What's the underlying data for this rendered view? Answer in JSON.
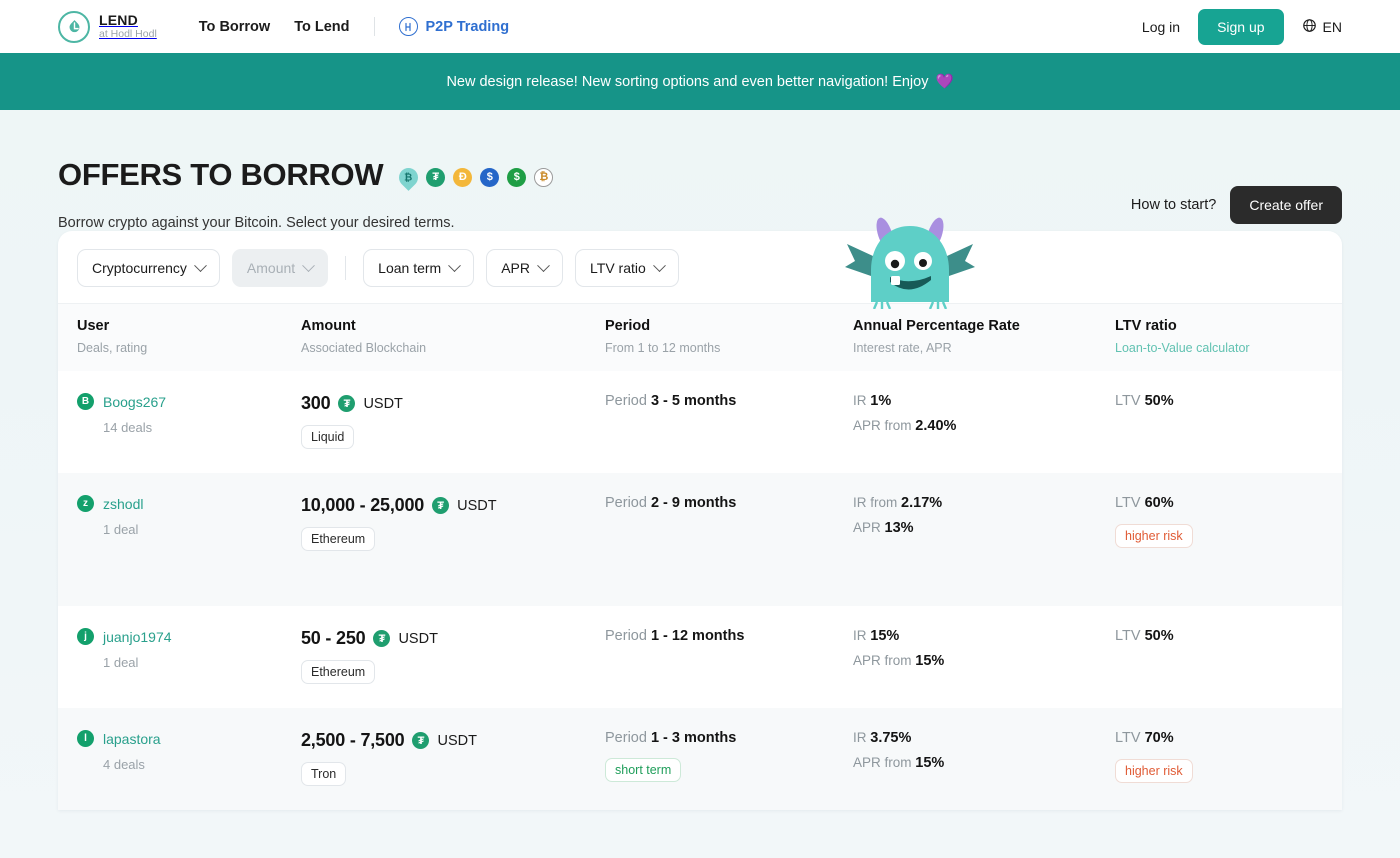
{
  "header": {
    "logo": {
      "title": "LEND",
      "subtitle": "at Hodl Hodl",
      "icon": "lend-leaf-icon"
    },
    "nav": [
      {
        "label": "To Borrow"
      },
      {
        "label": "To Lend"
      }
    ],
    "p2p": {
      "label": "P2P Trading",
      "icon": "p2p-hodlhodl-icon",
      "color": "#2f6fd0"
    },
    "login_label": "Log in",
    "signup_label": "Sign up",
    "language": {
      "label": "EN",
      "icon": "globe-icon"
    }
  },
  "banner": {
    "text": "New design release! New sorting options and even better navigation! Enjoy",
    "emoji": "💜",
    "background": "#169488"
  },
  "hero": {
    "title": "Offers to borrow",
    "subtitle": "Borrow crypto against your Bitcoin. Select your desired terms.",
    "coins": [
      {
        "name": "liquid-bitcoin-icon",
        "symbol": "₿",
        "class": "liquid"
      },
      {
        "name": "tether-icon",
        "symbol": "₮",
        "class": "usdt"
      },
      {
        "name": "dai-icon",
        "symbol": "Đ",
        "class": "dai"
      },
      {
        "name": "usdc-icon",
        "symbol": "$",
        "class": "usdc"
      },
      {
        "name": "usd-icon",
        "symbol": "$",
        "class": "usdx"
      },
      {
        "name": "bitcoin-icon",
        "symbol": "₿",
        "class": "btc"
      }
    ],
    "how_to_start": "How to start?",
    "create_offer": "Create offer",
    "mascot": "monster-mascot-illustration"
  },
  "filters": [
    {
      "label": "Cryptocurrency",
      "disabled": false
    },
    {
      "label": "Amount",
      "disabled": true
    },
    {
      "label": "Loan term",
      "disabled": false
    },
    {
      "label": "APR",
      "disabled": false
    },
    {
      "label": "LTV ratio",
      "disabled": false
    }
  ],
  "table": {
    "columns": [
      {
        "title": "User",
        "sub": "Deals, rating",
        "sub_is_link": false
      },
      {
        "title": "Amount",
        "sub": "Associated Blockchain",
        "sub_is_link": false
      },
      {
        "title": "Period",
        "sub": "From 1 to 12 months",
        "sub_is_link": false
      },
      {
        "title": "Annual Percentage Rate",
        "sub": "Interest rate, APR",
        "sub_is_link": false
      },
      {
        "title": "LTV ratio",
        "sub": "Loan-to-Value calculator",
        "sub_is_link": true
      }
    ],
    "rows": [
      {
        "avatar": "B",
        "username": "Boogs267",
        "deals": "14 deals",
        "amount": "300",
        "currency": "USDT",
        "blockchain": "Liquid",
        "period_label": "Period",
        "period_value": "3 - 5 months",
        "period_tag": "",
        "rate1_label": "IR",
        "rate1_value": "1%",
        "rate2_label": "APR from",
        "rate2_value": "2.40%",
        "ltv_label": "LTV",
        "ltv_value": "50%",
        "risk": ""
      },
      {
        "avatar": "z",
        "username": "zshodl",
        "deals": "1 deal",
        "amount": "10,000 - 25,000",
        "currency": "USDT",
        "blockchain": "Ethereum",
        "period_label": "Period",
        "period_value": "2 - 9 months",
        "period_tag": "",
        "rate1_label": "IR from",
        "rate1_value": "2.17%",
        "rate2_label": "APR",
        "rate2_value": "13%",
        "ltv_label": "LTV",
        "ltv_value": "60%",
        "risk": "higher risk"
      },
      {
        "avatar": "j",
        "username": "juanjo1974",
        "deals": "1 deal",
        "amount": "50 - 250",
        "currency": "USDT",
        "blockchain": "Ethereum",
        "period_label": "Period",
        "period_value": "1 - 12 months",
        "period_tag": "",
        "rate1_label": "IR",
        "rate1_value": "15%",
        "rate2_label": "APR from",
        "rate2_value": "15%",
        "ltv_label": "LTV",
        "ltv_value": "50%",
        "risk": ""
      },
      {
        "avatar": "l",
        "username": "lapastora",
        "deals": "4 deals",
        "amount": "2,500 - 7,500",
        "currency": "USDT",
        "blockchain": "Tron",
        "period_label": "Period",
        "period_value": "1 - 3 months",
        "period_tag": "short term",
        "rate1_label": "IR",
        "rate1_value": "3.75%",
        "rate2_label": "APR from",
        "rate2_value": "15%",
        "ltv_label": "LTV",
        "ltv_value": "70%",
        "risk": "higher risk"
      }
    ]
  }
}
